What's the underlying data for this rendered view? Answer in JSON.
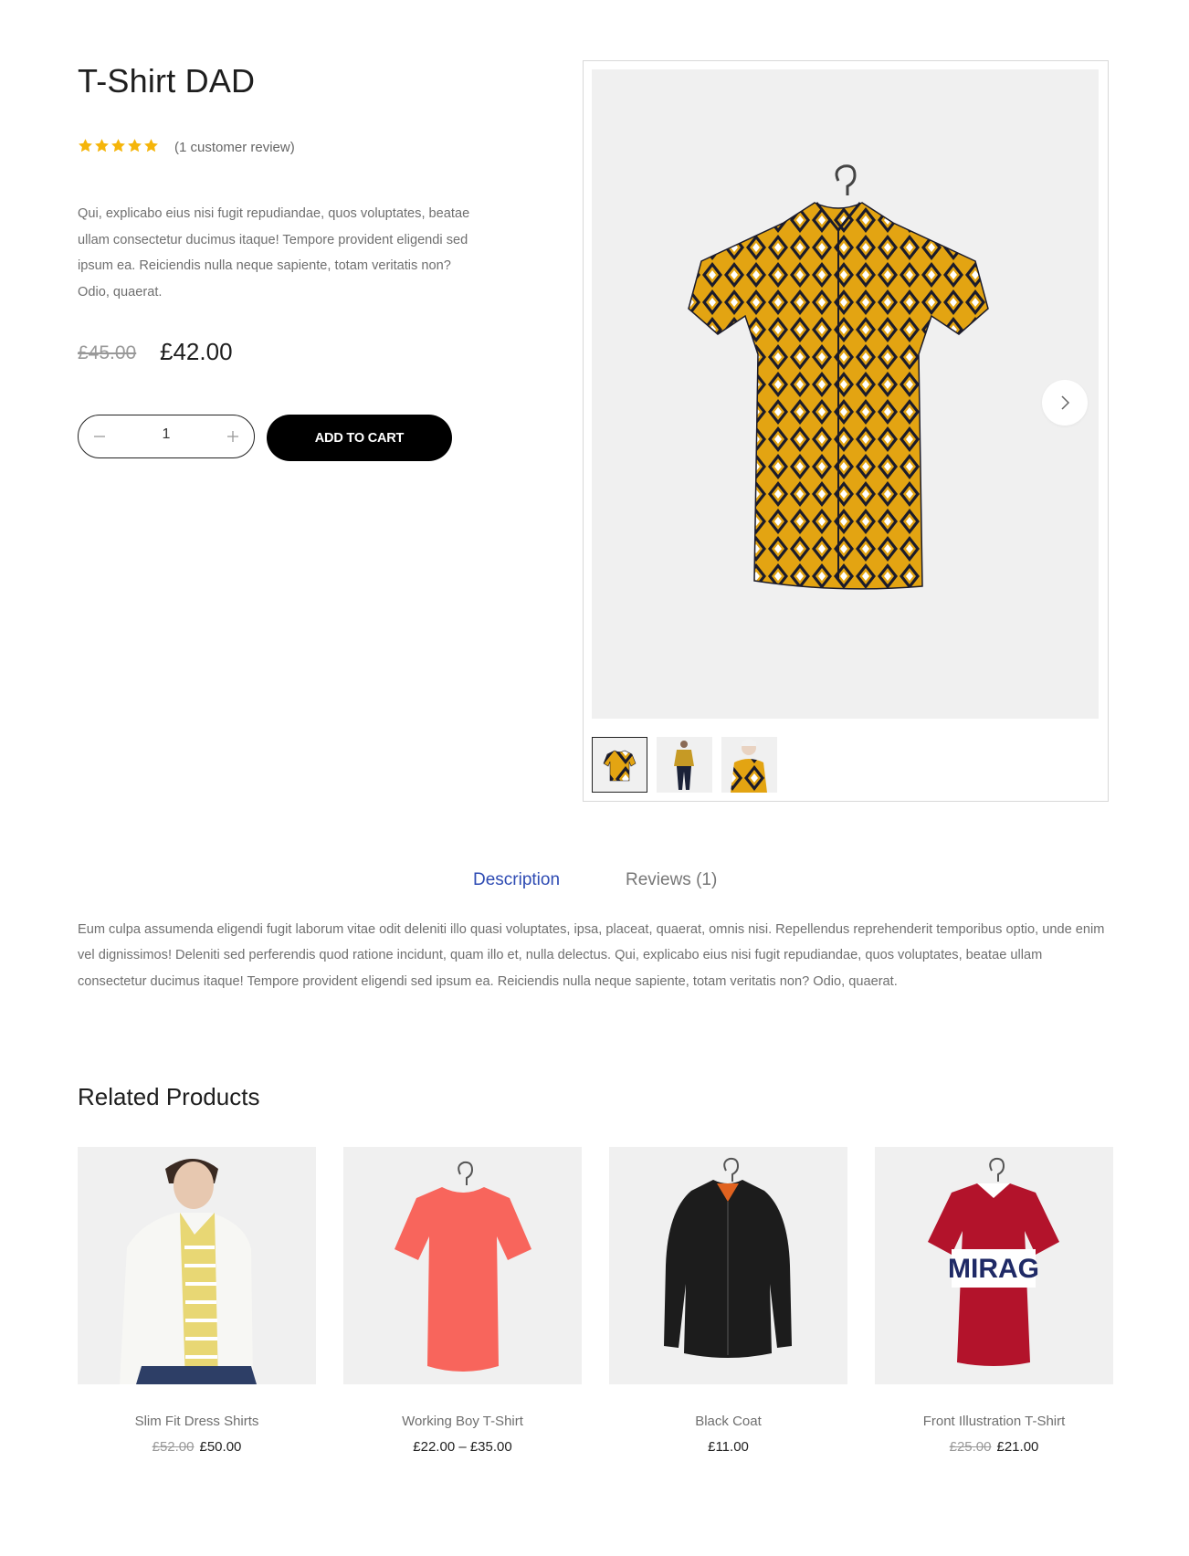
{
  "product": {
    "title": "T-Shirt DAD",
    "rating": 5,
    "review_link": "(1 customer review)",
    "short_description": "Qui, explicabo eius nisi fugit repudiandae, quos voluptates, beatae ullam consectetur ducimus itaque! Tempore provident eligendi sed ipsum ea. Reiciendis nulla neque sapiente, totam veritatis non? Odio, quaerat.",
    "price_old": "£45.00",
    "price_new": "£42.00",
    "quantity": "1",
    "add_to_cart_label": "ADD TO CART"
  },
  "tabs": {
    "description_label": "Description",
    "reviews_label": "Reviews (1)",
    "description_text": "Eum culpa assumenda eligendi fugit laborum vitae odit deleniti illo quasi voluptates, ipsa, placeat, quaerat, omnis nisi. Repellendus reprehenderit temporibus optio, unde enim vel dignissimos! Deleniti sed perferendis quod ratione incidunt, quam illo et, nulla delectus. Qui, explicabo eius nisi fugit repudiandae, quos voluptates, beatae ullam consectetur ducimus itaque! Tempore provident eligendi sed ipsum ea. Reiciendis nulla neque sapiente, totam veritatis non? Odio, quaerat."
  },
  "related": {
    "title": "Related Products",
    "items": [
      {
        "name": "Slim Fit Dress Shirts",
        "price_old": "£52.00",
        "price": "£50.00"
      },
      {
        "name": "Working Boy T-Shirt",
        "price_old": "",
        "price": "£22.00 – £35.00"
      },
      {
        "name": "Black Coat",
        "price_old": "",
        "price": "£11.00"
      },
      {
        "name": "Front Illustration T-Shirt",
        "price_old": "£25.00",
        "price": "£21.00"
      }
    ],
    "shirt_text": "MIRAG"
  },
  "colors": {
    "star": "#f5b50a",
    "tab_active": "#2e4bb3",
    "button_bg": "#000000",
    "image_bg": "#f0f0f0"
  },
  "icons": [
    "star-icon",
    "minus-icon",
    "plus-icon",
    "chevron-right-icon"
  ]
}
